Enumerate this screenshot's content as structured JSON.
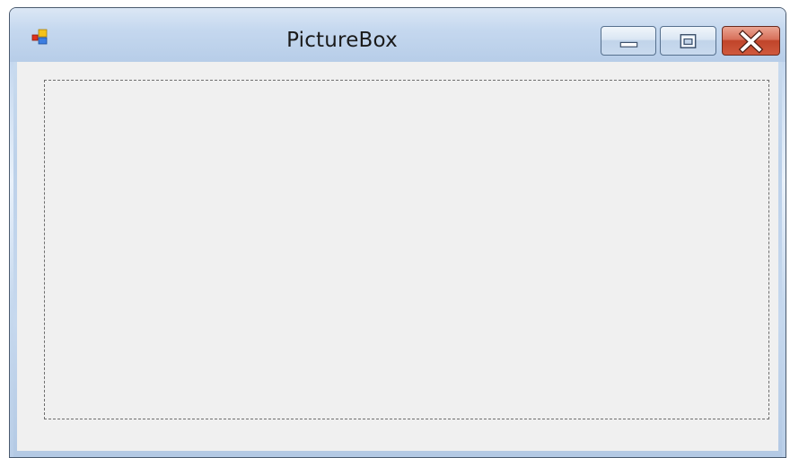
{
  "window": {
    "title": "PictureBox",
    "icon": "windows-forms-app-icon",
    "caption_buttons": {
      "minimize_icon": "minimize-icon",
      "maximize_icon": "maximize-icon",
      "close_icon": "close-icon"
    }
  },
  "colors": {
    "client_background": "#f0f0f0",
    "close_button": "#c74a32",
    "frame": "#bcd1ea"
  }
}
